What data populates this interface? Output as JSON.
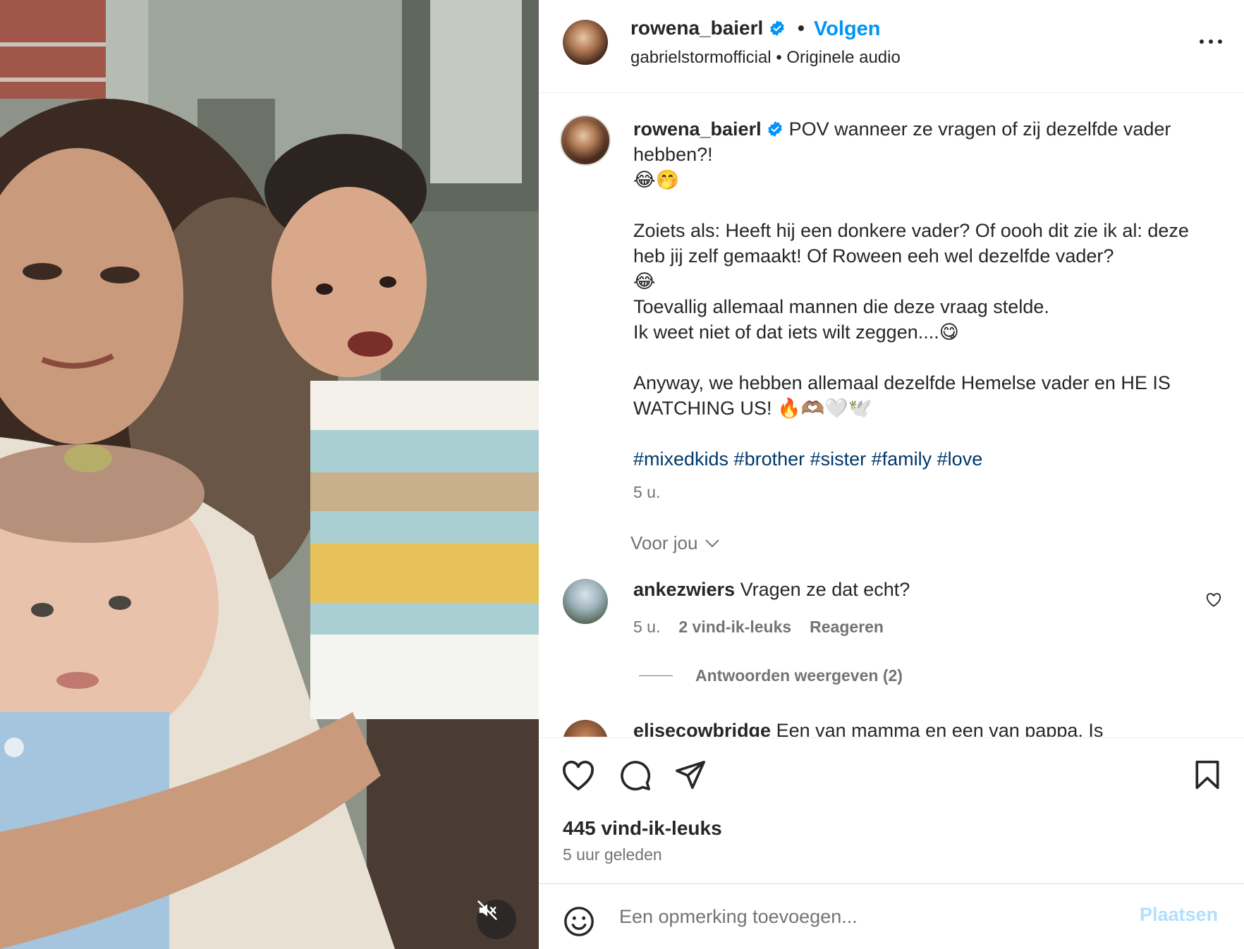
{
  "header": {
    "username": "rowena_baierl",
    "separator": "•",
    "follow_label": "Volgen",
    "audio_source": "gabrielstormofficial",
    "audio_separator": "•",
    "audio_label": "Originele audio"
  },
  "caption": {
    "username": "rowena_baierl",
    "lines": [
      "POV wanneer ze vragen of zij dezelfde vader hebben?!",
      "😂🤭",
      "",
      "Zoiets als: Heeft hij een donkere vader? Of oooh dit zie ik al: deze heb jij zelf gemaakt! Of Roween eeh wel dezelfde vader?",
      "😂",
      "Toevallig allemaal mannen die deze vraag stelde.",
      "Ik weet niet of dat iets wilt zeggen....😋",
      "",
      "Anyway, we hebben allemaal dezelfde Hemelse vader en HE IS WATCHING US! 🔥🫶🏽🤍🕊️",
      ""
    ],
    "hashtags": "#mixedkids #brother #sister #family #love",
    "time": "5 u."
  },
  "sort_label": "Voor jou",
  "comments": [
    {
      "username": "ankezwiers",
      "text": "Vragen ze dat echt?",
      "time": "5 u.",
      "likes": "2 vind-ik-leuks",
      "reply_label": "Reageren",
      "view_replies": "Antwoorden weergeven (2)"
    },
    {
      "username": "elisecowbridge",
      "text": "Een van mamma en een van pappa. Is"
    }
  ],
  "actions": {
    "likes_count": "445 vind-ik-leuks",
    "posted_ago": "5 uur geleden"
  },
  "add_comment": {
    "placeholder": "Een opmerking toevoegen...",
    "post_label": "Plaatsen"
  },
  "colors": {
    "accent": "#0095f6",
    "hashtag": "#00376b",
    "muted_text": "#737373",
    "post_disabled": "#b2dffc"
  },
  "icons": [
    "verified-badge-icon",
    "more-options-icon",
    "chevron-down-icon",
    "heart-icon",
    "comment-icon",
    "share-icon",
    "save-icon",
    "emoji-icon",
    "muted-audio-icon"
  ]
}
